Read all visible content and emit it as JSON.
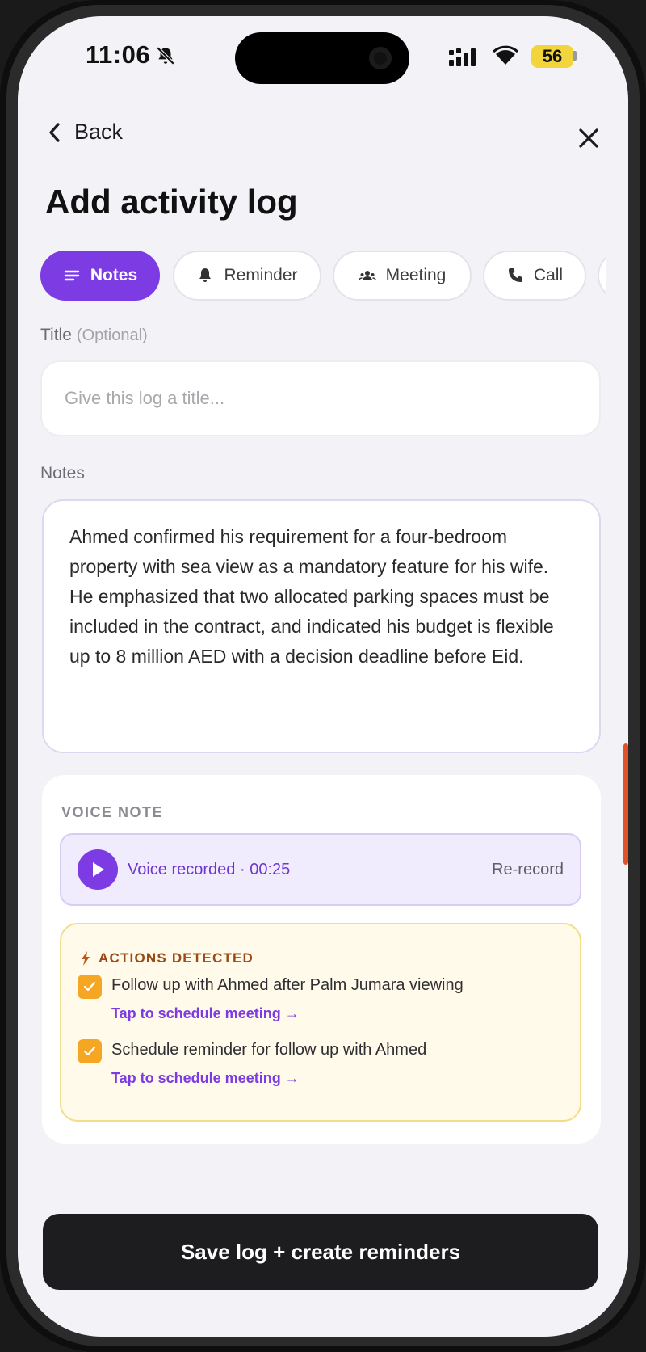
{
  "status_bar": {
    "time": "11:06",
    "battery": "56",
    "icons": [
      "bell-slash-icon",
      "signal-icon",
      "wifi-icon",
      "battery-icon"
    ]
  },
  "nav": {
    "back_label": "Back",
    "close_icon": "close-icon"
  },
  "page": {
    "title": "Add activity log"
  },
  "tabs": [
    {
      "label": "Notes",
      "icon": "notes-icon",
      "active": true
    },
    {
      "label": "Reminder",
      "icon": "bell-icon",
      "active": false
    },
    {
      "label": "Meeting",
      "icon": "people-icon",
      "active": false
    },
    {
      "label": "Call",
      "icon": "phone-icon",
      "active": false
    }
  ],
  "title_field": {
    "label": "Title",
    "optional": "(Optional)",
    "placeholder": "Give this log a title...",
    "value": ""
  },
  "notes_field": {
    "label": "Notes",
    "value": "Ahmed confirmed his requirement for a four-bedroom property with sea view as a mandatory feature for his wife. He emphasized that two allocated parking spaces must be included in the contract, and indicated his budget is flexible up to 8 million AED with a decision deadline before Eid."
  },
  "voice_note": {
    "heading": "VOICE NOTE",
    "status": "Voice recorded · 00:25",
    "rerecord_label": "Re-record"
  },
  "actions": {
    "heading": "ACTIONS DETECTED",
    "items": [
      {
        "text": "Follow up with Ahmed after Palm Jumara viewing",
        "link": "Tap to schedule meeting →",
        "checked": true
      },
      {
        "text": "Schedule reminder for follow up with Ahmed",
        "link": "Tap to schedule meeting →",
        "checked": true
      }
    ]
  },
  "footer": {
    "save_label": "Save log + create reminders"
  },
  "colors": {
    "accent": "#7c3be3",
    "checkbox": "#f5a623",
    "actions_bg": "#fffaea",
    "button_dark": "#1d1d1f"
  }
}
